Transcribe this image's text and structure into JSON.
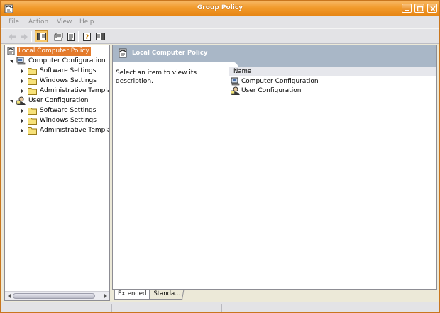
{
  "window": {
    "title": "Group Policy"
  },
  "menu": [
    "File",
    "Action",
    "View",
    "Help"
  ],
  "toolbar": {
    "buttons": [
      "back-icon",
      "forward-icon",
      "show-hide-tree-icon",
      "properties-icon",
      "export-list-icon",
      "help-icon",
      "show-hide-action-pane-icon"
    ]
  },
  "tree": {
    "root": "Local Computer Policy",
    "computer_configuration": {
      "label": "Computer Configuration",
      "children": [
        "Software Settings",
        "Windows Settings",
        "Administrative Templat"
      ]
    },
    "user_configuration": {
      "label": "User Configuration",
      "children": [
        "Software Settings",
        "Windows Settings",
        "Administrative Templat"
      ]
    }
  },
  "details": {
    "header": "Local Computer Policy",
    "description": "Select an item to view its description.",
    "column_name": "Name",
    "items": [
      "Computer Configuration",
      "User Configuration"
    ]
  },
  "tabs": {
    "extended": "Extended",
    "standard": "Standa..."
  },
  "colors": {
    "titlebar": "#f29b2c",
    "selection": "#e47b2c",
    "header_band": "#a9b7c7"
  }
}
